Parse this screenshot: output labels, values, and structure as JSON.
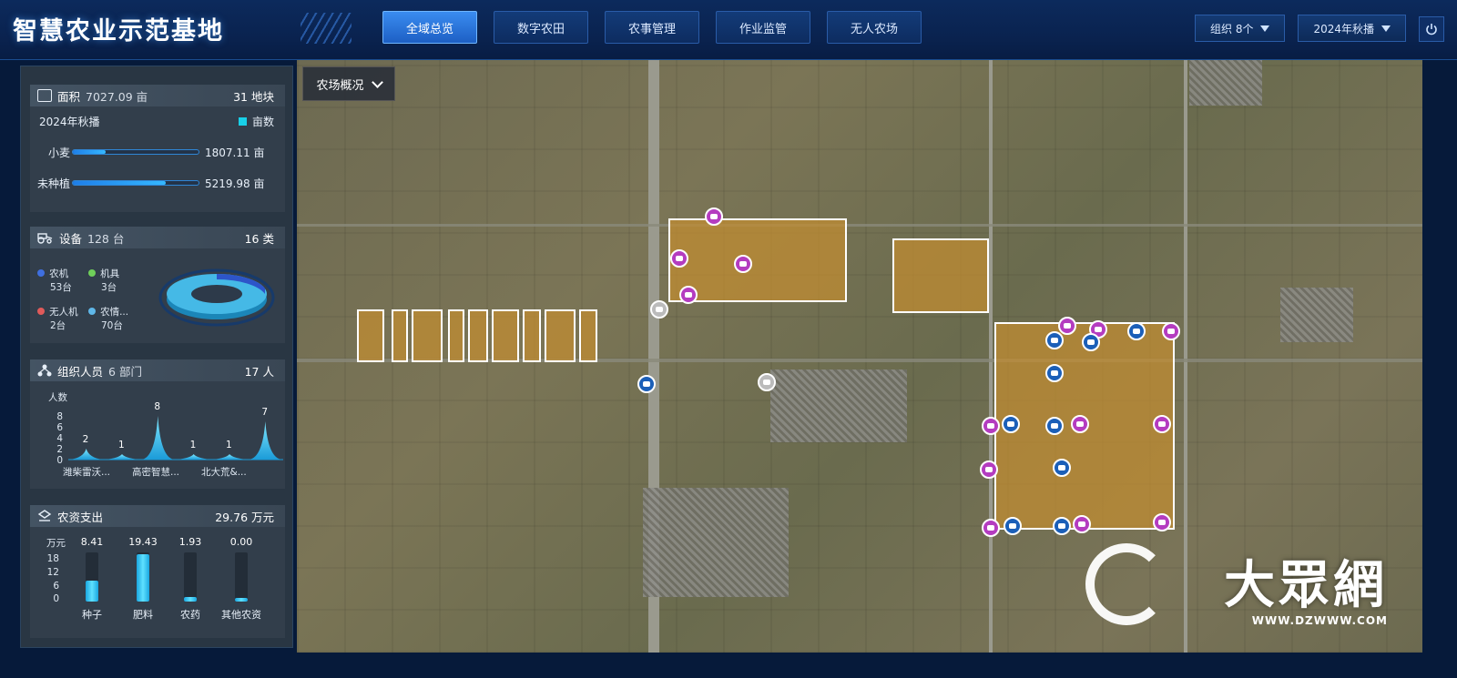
{
  "app": {
    "title": "智慧农业示范基地",
    "tabs": [
      {
        "label": "全域总览",
        "active": true
      },
      {
        "label": "数字农田",
        "active": false
      },
      {
        "label": "农事管理",
        "active": false
      },
      {
        "label": "作业监管",
        "active": false
      },
      {
        "label": "无人农场",
        "active": false
      }
    ],
    "org_select": "组织 8个",
    "season_select": "2024年秋播",
    "power_icon": "power-icon"
  },
  "map": {
    "farm_overview_label": "农场概况",
    "watermark_text": "大眾網",
    "watermark_url": "WWW.DZWWW.COM"
  },
  "area": {
    "title_prefix": "面积",
    "total": "7027.09 亩",
    "plots": "31 地块",
    "season": "2024年秋播",
    "legend": "亩数",
    "legend_color": "#18d0e8",
    "rows": [
      {
        "name": "小麦",
        "value": "1807.11 亩",
        "fraction": 0.26
      },
      {
        "name": "未种植",
        "value": "5219.98 亩",
        "fraction": 0.74
      }
    ]
  },
  "equipment": {
    "title_prefix": "设备",
    "total": "128 台",
    "categories": "16 类",
    "legend": [
      {
        "name": "农机",
        "count": "53台",
        "color": "#3f6fe0"
      },
      {
        "name": "机具",
        "count": "3台",
        "color": "#6fcf5a"
      },
      {
        "name": "无人机",
        "count": "2台",
        "color": "#e05a5a"
      },
      {
        "name": "农情...",
        "count": "70台",
        "color": "#5fb7e8"
      }
    ]
  },
  "org": {
    "title_prefix": "组织人员",
    "departments": "6 部门",
    "people": "17 人",
    "y_label": "人数",
    "y_ticks": [
      "8",
      "6",
      "4",
      "2",
      "0"
    ],
    "values": [
      2,
      1,
      8,
      1,
      1,
      7
    ],
    "value_labels": [
      "2",
      "1",
      "8",
      "1",
      "1",
      "7"
    ],
    "x_labels": [
      "潍柴雷沃...",
      "高密智慧...",
      "北大荒&..."
    ]
  },
  "supplies": {
    "title": "农资支出",
    "total": "29.76 万元",
    "y_unit": "万元",
    "y_ticks": [
      "18",
      "12",
      "6",
      "0"
    ],
    "items": [
      {
        "name": "种子",
        "value": "8.41",
        "num": 8.41
      },
      {
        "name": "肥料",
        "value": "19.43",
        "num": 19.43
      },
      {
        "name": "农药",
        "value": "1.93",
        "num": 1.93
      },
      {
        "name": "其他农资",
        "value": "0.00",
        "num": 0.0
      }
    ]
  }
}
